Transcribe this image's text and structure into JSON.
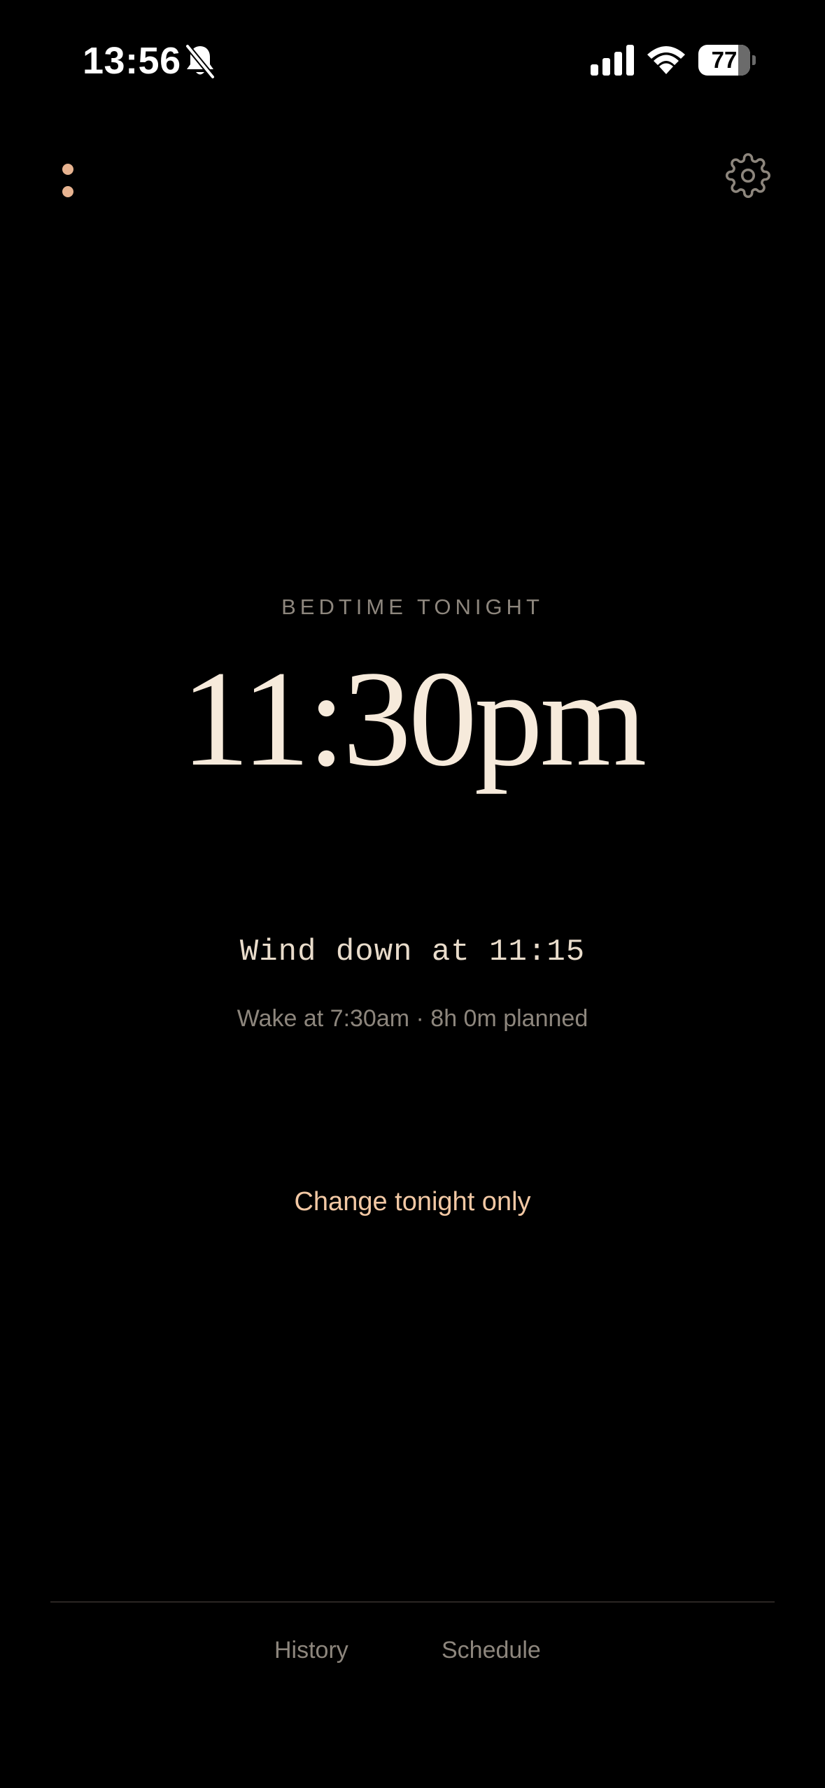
{
  "status_bar": {
    "time": "13:56",
    "battery_level": "77",
    "icons": [
      "bell-slash-icon",
      "cellular-signal-icon",
      "wifi-icon",
      "battery-icon"
    ]
  },
  "header": {
    "menu_icon": "more-vertical-icon",
    "settings_icon": "gear-icon"
  },
  "main": {
    "section_label": "BEDTIME TONIGHT",
    "bedtime": "11:30pm",
    "wind_down": "Wind down at 11:15",
    "wake_info": "Wake at 7:30am · 8h 0m planned",
    "change_link": "Change tonight only"
  },
  "bottom_nav": {
    "items": [
      {
        "label": "History"
      },
      {
        "label": "Schedule"
      }
    ]
  },
  "colors": {
    "background": "#000000",
    "accent": "#e7b390",
    "primary_text": "#f6eadb",
    "muted_text": "#8d867d",
    "link": "#f2c8a4"
  }
}
